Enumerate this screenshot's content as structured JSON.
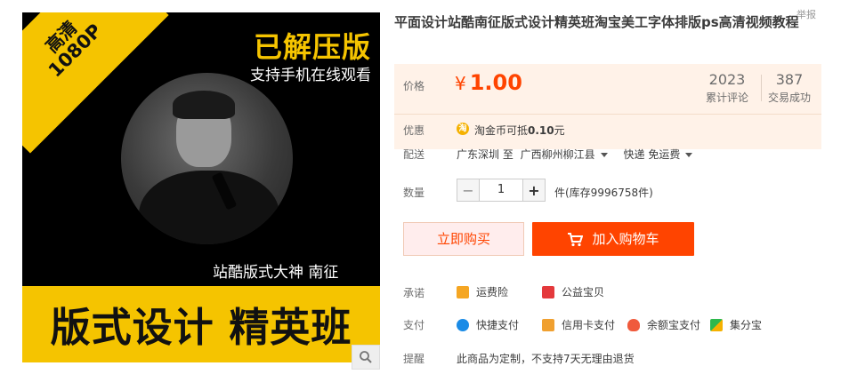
{
  "image": {
    "corner_line1": "高清",
    "corner_line2": "1080P",
    "headline": "已解压版",
    "subline": "支持手机在线观看",
    "speaker": "站酷版式大神 南征",
    "band": "版式设计 精英班"
  },
  "title": "平面设计站酷南征版式设计精英班淘宝美工字体排版ps高清视频教程",
  "top_cut_text": "举报",
  "price_label": "价格",
  "currency": "¥",
  "price": "1.00",
  "reviews": {
    "count": "2023",
    "label": "累计评论"
  },
  "sales": {
    "count": "387",
    "label": "交易成功"
  },
  "promo": {
    "label": "优惠",
    "coin_icon": "淘",
    "text_prefix": "淘金币可抵",
    "amount": "0.10",
    "text_suffix": "元"
  },
  "delivery": {
    "label": "配送",
    "from": "广东深圳 至",
    "to": "广西柳州柳江县",
    "method": "快递 免运费"
  },
  "quantity": {
    "label": "数量",
    "minus": "−",
    "value": "1",
    "plus": "+",
    "stock": "件(库存9996758件)"
  },
  "buttons": {
    "buy_now": "立即购买",
    "add_to_cart": "加入购物车"
  },
  "promise": {
    "label": "承诺",
    "items": [
      "运费险",
      "公益宝贝"
    ]
  },
  "payment": {
    "label": "支付",
    "items": [
      "快捷支付",
      "信用卡支付",
      "余额宝支付",
      "集分宝"
    ]
  },
  "reminder": {
    "label": "提醒",
    "text": "此商品为定制，不支持7天无理由退货"
  },
  "colors": {
    "accent": "#ff4400",
    "price_bg": "#fff2e8",
    "poster_yellow": "#f5c400"
  }
}
